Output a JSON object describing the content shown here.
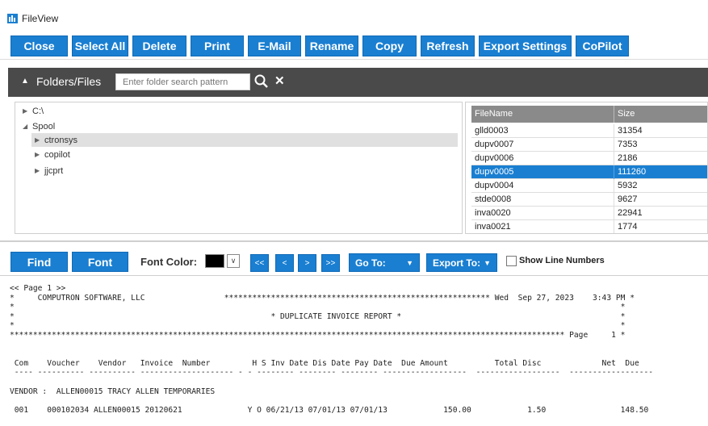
{
  "window": {
    "title": "FileView"
  },
  "toolbar": {
    "buttons": [
      "Close",
      "Select All",
      "Delete",
      "Print",
      "E-Mail",
      "Rename",
      "Copy",
      "Refresh",
      "Export Settings",
      "CoPilot"
    ]
  },
  "folders": {
    "label": "Folders/Files",
    "search_placeholder": "Enter folder search pattern",
    "tree": [
      {
        "label": "C:\\"
      },
      {
        "label": "Spool"
      },
      {
        "label": "ctronsys"
      },
      {
        "label": "copilot"
      },
      {
        "label": "jjcprt"
      }
    ]
  },
  "files": {
    "headers": [
      "FileName",
      "Size"
    ],
    "rows": [
      {
        "name": "glld0003",
        "size": "31354"
      },
      {
        "name": "dupv0007",
        "size": "7353"
      },
      {
        "name": "dupv0006",
        "size": "2186"
      },
      {
        "name": "dupv0005",
        "size": "111260"
      },
      {
        "name": "dupv0004",
        "size": "5932"
      },
      {
        "name": "stde0008",
        "size": "9627"
      },
      {
        "name": "inva0020",
        "size": "22941"
      },
      {
        "name": "inva0021",
        "size": "1774"
      }
    ],
    "selected": "dupv0005"
  },
  "findbar": {
    "find": "Find",
    "font": "Font",
    "font_color_label": "Font Color:",
    "font_color": "#000000",
    "nav": [
      "<<",
      "<",
      ">",
      ">>"
    ],
    "goto": "Go To:",
    "export_to": "Export To:",
    "show_line_numbers": "Show Line Numbers"
  },
  "report": {
    "lines": [
      "<< Page 1 >>",
      "*     COMPUTRON SOFTWARE, LLC                 ********************************************************* Wed  Sep 27, 2023    3:43 PM *",
      "*                                                                                                                                  *",
      "*                                                       * DUPLICATE INVOICE REPORT *                                               *",
      "*                                                                                                                                  *",
      "*********************************************************************************************************************** Page     1 *",
      "",
      "",
      " Com    Voucher    Vendor   Invoice  Number         H S Inv Date Dis Date Pay Date  Due Amount          Total Disc             Net  Due",
      " ---- ---------- ---------- -------------------- - - -------- -------- -------- ------------------  ------------------  ------------------",
      "",
      "VENDOR :  ALLEN00015 TRACY ALLEN TEMPORARIES",
      "",
      " 001    000102034 ALLEN00015 20120621              Y O 06/21/13 07/01/13 07/01/13            150.00            1.50                148.50"
    ]
  },
  "colors": {
    "accent": "#1a7fd1",
    "header_dark": "#4a4a4a",
    "selection": "#1a7fd1"
  },
  "icons": [
    "app-icon",
    "caret-up-icon",
    "search-icon",
    "close-icon",
    "triangle-right-icon",
    "triangle-down-icon",
    "chevron-down-icon",
    "checkbox-icon"
  ]
}
